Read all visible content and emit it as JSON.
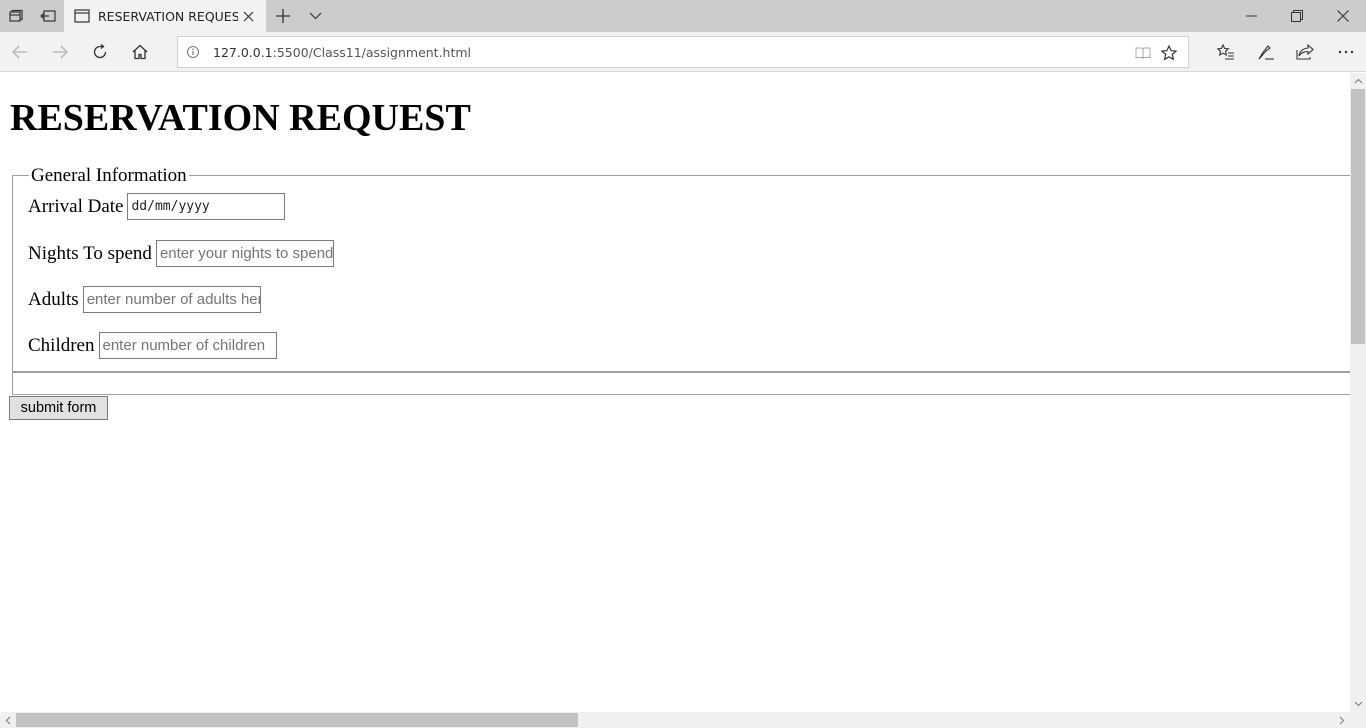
{
  "browser": {
    "tab_title": "RESERVATION REQUEST",
    "url_host": "127.0.0.1",
    "url_rest": ":5500/Class11/assignment.html",
    "icons": [
      "tab-preview-icon",
      "set-aside-tabs-icon",
      "page-icon",
      "close-tab-icon",
      "new-tab-icon",
      "tab-list-icon",
      "minimize-icon",
      "restore-icon",
      "close-window-icon",
      "back-icon",
      "forward-icon",
      "refresh-icon",
      "home-icon",
      "info-icon",
      "reading-view-icon",
      "favorite-star-icon",
      "favorites-hub-icon",
      "pen-icon",
      "share-icon",
      "more-icon"
    ]
  },
  "page": {
    "title": "RESERVATION REQUEST",
    "fieldset_legend": "General Information",
    "fields": {
      "arrival": {
        "label": "Arrival Date",
        "value": "dd/mm/yyyy"
      },
      "nights": {
        "label": "Nights To spend",
        "placeholder": "enter your nights to spend"
      },
      "adults": {
        "label": "Adults",
        "placeholder": "enter number of adults here"
      },
      "children": {
        "label": "Children",
        "placeholder": "enter number of children"
      }
    },
    "submit_label": "submit form"
  }
}
